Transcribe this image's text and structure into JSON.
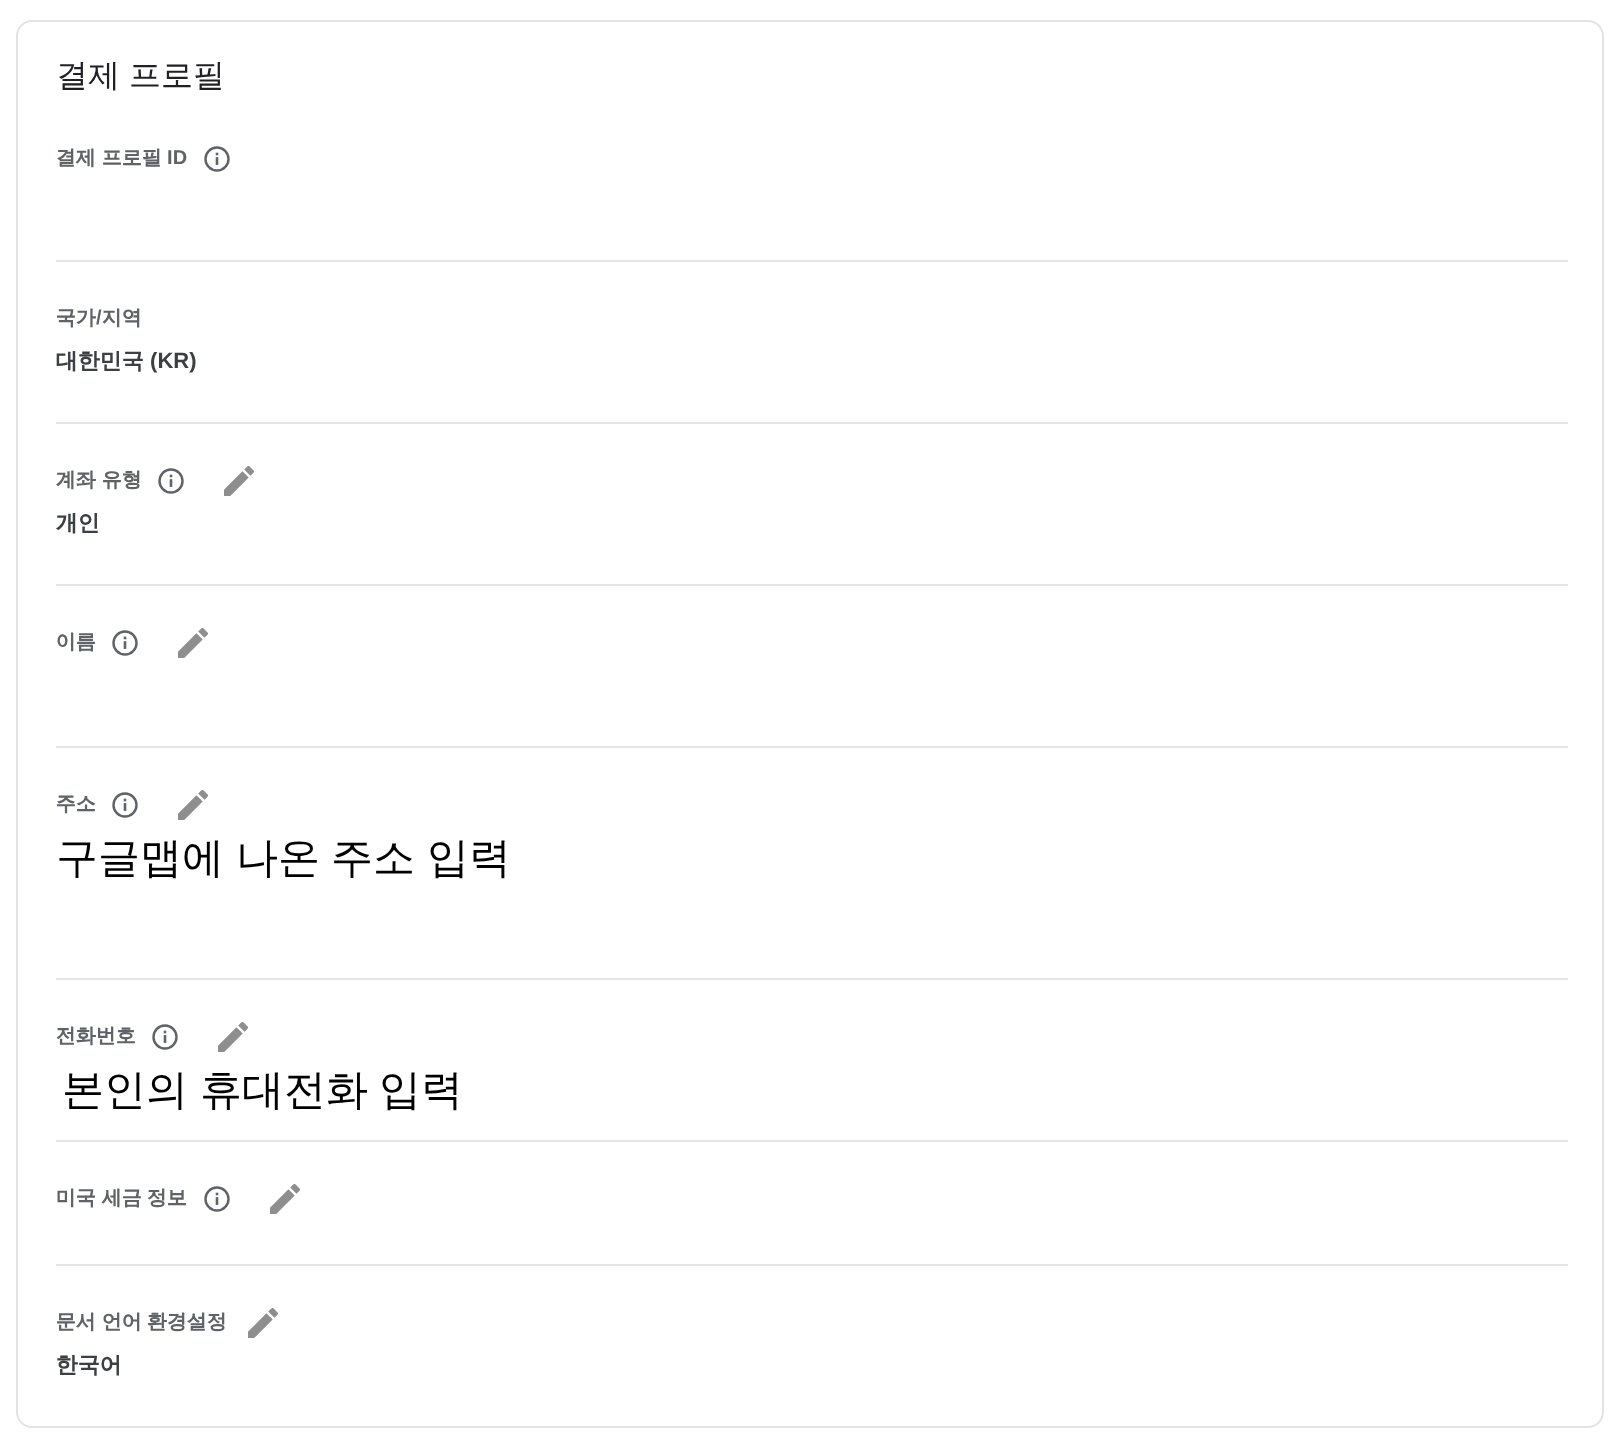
{
  "title": "결제 프로필",
  "fields": [
    {
      "label": "결제 프로필 ID",
      "info": true,
      "editable": false
    },
    {
      "label": "국가/지역",
      "info": false,
      "editable": false,
      "value": {
        "kind": "plain",
        "text": "대한민국 (KR)"
      }
    },
    {
      "label": "계좌 유형",
      "info": true,
      "editable": true,
      "value": {
        "kind": "plain",
        "text": "개인"
      }
    },
    {
      "label": "이름",
      "info": true,
      "editable": true
    },
    {
      "label": "주소",
      "info": true,
      "editable": true,
      "value": {
        "kind": "note",
        "text": "구글맵에 나온 주소 입력"
      }
    },
    {
      "label": "전화번호",
      "info": true,
      "editable": true,
      "value": {
        "kind": "note",
        "text": "본인의 휴대전화 입력"
      }
    },
    {
      "label": "미국 세금 정보",
      "info": true,
      "editable": true
    },
    {
      "label": "문서 언어 환경설정",
      "info": false,
      "editable": true,
      "value": {
        "kind": "plain",
        "text": "한국어"
      }
    }
  ]
}
